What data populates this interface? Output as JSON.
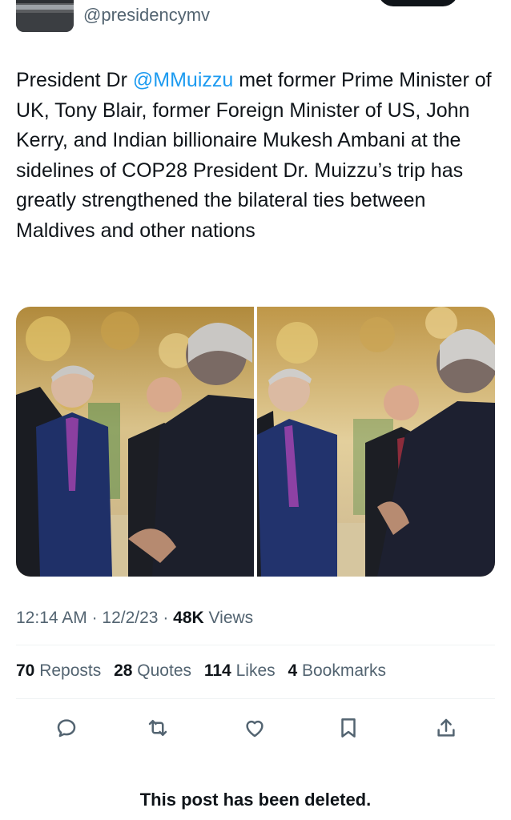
{
  "header": {
    "handle": "@presidencymv",
    "avatar_icon": "presidency-building-avatar"
  },
  "tweet": {
    "text_before_mention": "President Dr ",
    "mention": "@MMuizzu",
    "text_after_mention": " met former Prime Minister of UK, Tony Blair, former Foreign Minister of US, John Kerry, and Indian billionaire Mukesh Ambani at the sidelines of COP28 President Dr. Muizzu’s trip has greatly strengthened the bilateral ties between Maldives and other nations",
    "mention_color": "#1d9bf0"
  },
  "meta": {
    "time": "12:14 AM",
    "sep1": " · ",
    "date": "12/2/23",
    "sep2": " · ",
    "views_count": "48K",
    "views_label": " Views"
  },
  "stats": [
    {
      "count": "70",
      "label": "Reposts"
    },
    {
      "count": "28",
      "label": "Quotes"
    },
    {
      "count": "114",
      "label": "Likes"
    },
    {
      "count": "4",
      "label": "Bookmarks"
    }
  ],
  "actions": [
    {
      "icon": "reply-icon"
    },
    {
      "icon": "repost-icon"
    },
    {
      "icon": "like-icon"
    },
    {
      "icon": "bookmark-icon"
    },
    {
      "icon": "share-icon"
    }
  ],
  "footer": {
    "deleted_notice": "This post has been deleted."
  }
}
